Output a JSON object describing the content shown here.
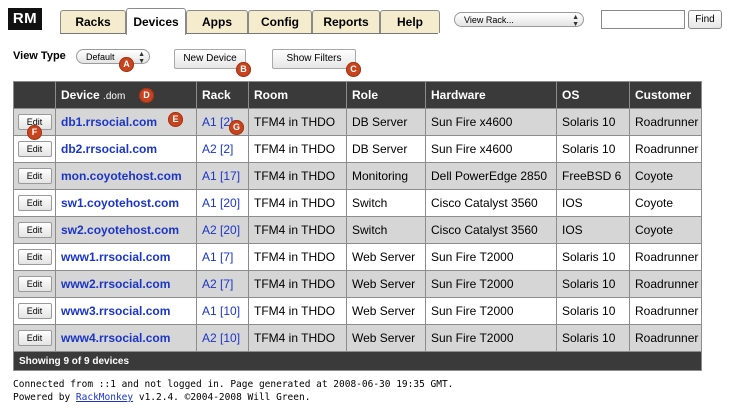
{
  "app": {
    "logo": "RM"
  },
  "tabs": [
    {
      "label": "Racks",
      "active": false
    },
    {
      "label": "Devices",
      "active": true
    },
    {
      "label": "Apps",
      "active": false
    },
    {
      "label": "Config",
      "active": false
    },
    {
      "label": "Reports",
      "active": false
    },
    {
      "label": "Help",
      "active": false
    }
  ],
  "header": {
    "view_rack_value": "View Rack...",
    "search_value": "",
    "find_label": "Find"
  },
  "controls": {
    "view_type_label": "View Type",
    "view_type_value": "Default",
    "new_device_label": "New Device",
    "show_filters_label": "Show Filters"
  },
  "markers": [
    "A",
    "B",
    "C",
    "D",
    "E",
    "F",
    "G"
  ],
  "table": {
    "columns": {
      "device": "Device",
      "domain": ".dom",
      "rack": "Rack",
      "room": "Room",
      "role": "Role",
      "hardware": "Hardware",
      "os": "OS",
      "customer": "Customer"
    },
    "edit_label": "Edit",
    "rows": [
      {
        "device": "db1.rrsocial.com",
        "rack": "A1",
        "pos": "[2]",
        "room": "TFM4 in THDO",
        "role": "DB Server",
        "hardware": "Sun Fire x4600",
        "os": "Solaris 10",
        "customer": "Roadrunner"
      },
      {
        "device": "db2.rrsocial.com",
        "rack": "A2",
        "pos": "[2]",
        "room": "TFM4 in THDO",
        "role": "DB Server",
        "hardware": "Sun Fire x4600",
        "os": "Solaris 10",
        "customer": "Roadrunner"
      },
      {
        "device": "mon.coyotehost.com",
        "rack": "A1",
        "pos": "[17]",
        "room": "TFM4 in THDO",
        "role": "Monitoring",
        "hardware": "Dell PowerEdge 2850",
        "os": "FreeBSD 6",
        "customer": "Coyote"
      },
      {
        "device": "sw1.coyotehost.com",
        "rack": "A1",
        "pos": "[20]",
        "room": "TFM4 in THDO",
        "role": "Switch",
        "hardware": "Cisco Catalyst 3560",
        "os": "IOS",
        "customer": "Coyote"
      },
      {
        "device": "sw2.coyotehost.com",
        "rack": "A2",
        "pos": "[20]",
        "room": "TFM4 in THDO",
        "role": "Switch",
        "hardware": "Cisco Catalyst 3560",
        "os": "IOS",
        "customer": "Coyote"
      },
      {
        "device": "www1.rrsocial.com",
        "rack": "A1",
        "pos": "[7]",
        "room": "TFM4 in THDO",
        "role": "Web Server",
        "hardware": "Sun Fire T2000",
        "os": "Solaris 10",
        "customer": "Roadrunner"
      },
      {
        "device": "www2.rrsocial.com",
        "rack": "A2",
        "pos": "[7]",
        "room": "TFM4 in THDO",
        "role": "Web Server",
        "hardware": "Sun Fire T2000",
        "os": "Solaris 10",
        "customer": "Roadrunner"
      },
      {
        "device": "www3.rrsocial.com",
        "rack": "A1",
        "pos": "[10]",
        "room": "TFM4 in THDO",
        "role": "Web Server",
        "hardware": "Sun Fire T2000",
        "os": "Solaris 10",
        "customer": "Roadrunner"
      },
      {
        "device": "www4.rrsocial.com",
        "rack": "A2",
        "pos": "[10]",
        "room": "TFM4 in THDO",
        "role": "Web Server",
        "hardware": "Sun Fire T2000",
        "os": "Solaris 10",
        "customer": "Roadrunner"
      }
    ],
    "summary": "Showing 9 of 9 devices"
  },
  "footer": {
    "line1": "Connected from ::1 and not logged in. Page generated at 2008-06-30 19:35 GMT.",
    "powered_prefix": "Powered by ",
    "powered_link": "RackMonkey",
    "powered_suffix": " v1.2.4. ©2004-2008 Will Green."
  }
}
